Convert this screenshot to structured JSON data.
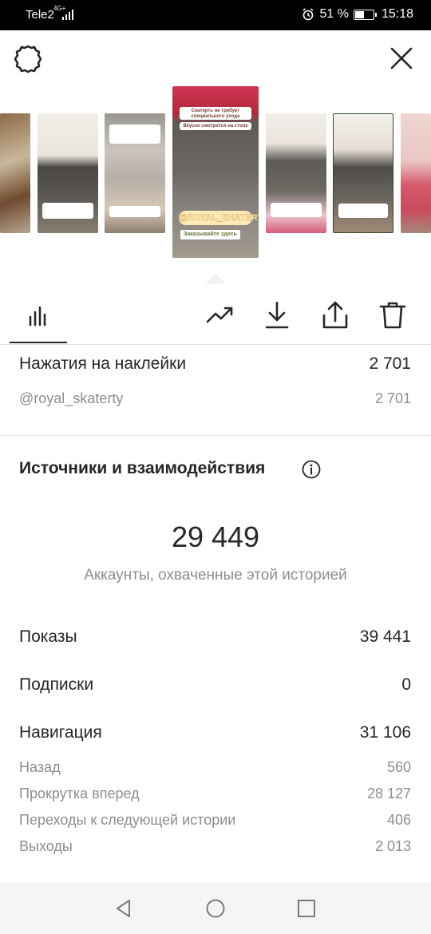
{
  "status_bar": {
    "carrier": "Tele2",
    "network": "4G+",
    "battery_percent": "51 %",
    "battery_level": 0.51,
    "time": "15:18"
  },
  "header": {
    "settings_icon": "gear-icon",
    "close_icon": "close-icon"
  },
  "stories": {
    "selected_caption_1": "Скатерть не требует специального ухода",
    "selected_caption_2": "Вкусно смотрится на столе",
    "selected_tag": "@ROYAL_SHATERTY",
    "selected_caption_3": "Заказывайте здесь"
  },
  "toolbar": {
    "tabs": [
      "insights-bars-icon",
      "trending-icon",
      "download-icon",
      "share-icon",
      "delete-icon"
    ]
  },
  "stickers": {
    "label": "Нажатия на наклейки",
    "value": "2 701",
    "sub_label": "@royal_skaterty",
    "sub_value": "2 701"
  },
  "section": {
    "title": "Источники и взаимодействия",
    "reach_value": "29 449",
    "reach_caption": "Аккаунты, охваченные этой историей"
  },
  "metrics": {
    "impressions_label": "Показы",
    "impressions_value": "39 441",
    "follows_label": "Подписки",
    "follows_value": "0",
    "navigation_label": "Навигация",
    "navigation_value": "31 106",
    "back_label": "Назад",
    "back_value": "560",
    "forward_label": "Прокрутка вперед",
    "forward_value": "28 127",
    "next_story_label": "Переходы к следующей истории",
    "next_story_value": "406",
    "exits_label": "Выходы",
    "exits_value": "2 013"
  },
  "colors": {
    "text": "#262626",
    "secondary": "#8e8e8e",
    "divider": "#dbdbdb"
  }
}
